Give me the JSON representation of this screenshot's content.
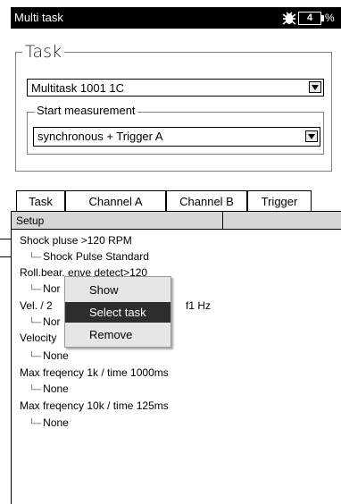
{
  "titlebar": {
    "title": "Multi task",
    "status_icon": "bug-icon",
    "battery_digit": "4",
    "battery_pct": "%"
  },
  "task_panel": {
    "legend": "Task",
    "task_select": "Multitask 1001 1C",
    "start_legend": "Start measurement",
    "start_select": "synchronous + Trigger A"
  },
  "tabs": [
    {
      "label": "Task"
    },
    {
      "label": "Channel A",
      "active": true
    },
    {
      "label": "Channel B"
    },
    {
      "label": "Trigger"
    }
  ],
  "table": {
    "header": "Setup",
    "rows": [
      {
        "text": "Shock pluse >120 RPM"
      },
      {
        "text": "Shock Pulse Standard"
      },
      {
        "text": "Roll.bear. enve detect>120"
      },
      {
        "text": "Nor"
      },
      {
        "text": "Vel. / 2"
      },
      {
        "text": "f1 Hz"
      },
      {
        "text": "Nor"
      },
      {
        "text": "Velocity"
      },
      {
        "text": "None"
      },
      {
        "text": "Max freqency 1k / time 1000ms"
      },
      {
        "text": "None"
      },
      {
        "text": "Max freqency 10k / time 125ms"
      },
      {
        "text": "None"
      }
    ]
  },
  "context_menu": {
    "items": [
      {
        "label": "Show"
      },
      {
        "label": "Select task",
        "highlighted": true
      },
      {
        "label": "Remove"
      }
    ]
  }
}
